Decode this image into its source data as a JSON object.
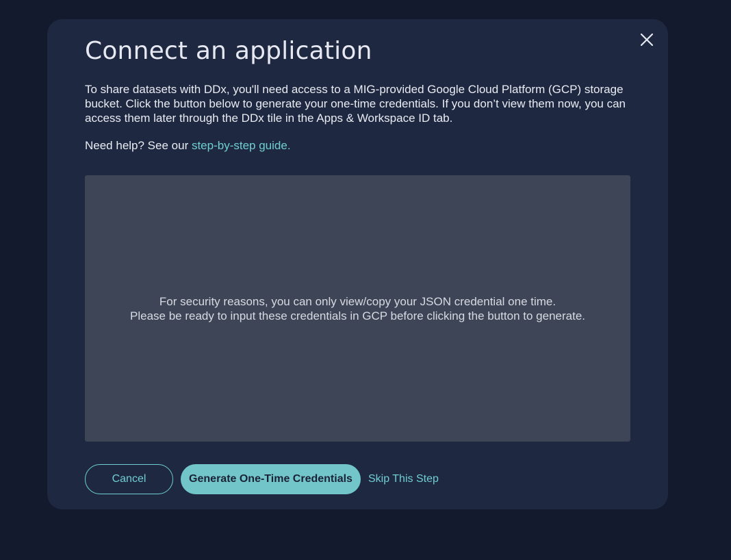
{
  "modal": {
    "title": "Connect an application",
    "intro": "To share datasets with DDx, you'll need access to a MIG-provided Google Cloud Platform (GCP) storage bucket. Click the button below to generate your one-time credentials. If you don’t view them now, you can access them later through the DDx tile in the Apps & Workspace ID tab.",
    "help_prefix": "Need help? See our ",
    "help_link": "step-by-step guide.",
    "close_icon": "close-icon"
  },
  "credential_box": {
    "line1": "For security reasons, you can only view/copy your JSON credential one time.",
    "line2": "Please be ready to input these credentials in GCP before clicking the button to generate."
  },
  "actions": {
    "cancel_label": "Cancel",
    "generate_label": "Generate One-Time Credentials",
    "skip_label": "Skip This Step"
  },
  "colors": {
    "background": "#141a2e",
    "modal": "#1f2841",
    "accent": "#6fcfd2",
    "credential_box": "#3e4556"
  }
}
